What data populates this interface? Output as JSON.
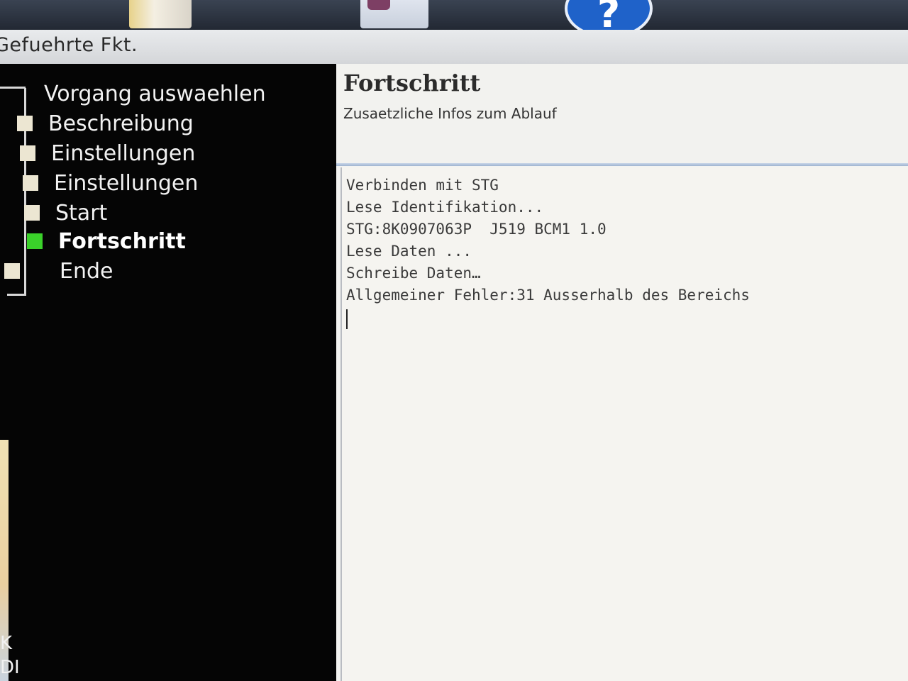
{
  "window": {
    "title": "Gefuehrte Fkt."
  },
  "taskbar": {
    "help_icon_glyph": "?"
  },
  "nav": {
    "items": [
      {
        "label": "Vorgang auswaehlen",
        "active": false
      },
      {
        "label": "Beschreibung",
        "active": false
      },
      {
        "label": "Einstellungen",
        "active": false
      },
      {
        "label": "Einstellungen",
        "active": false
      },
      {
        "label": "Start",
        "active": false
      },
      {
        "label": "Fortschritt",
        "active": true
      },
      {
        "label": "Ende",
        "active": false
      }
    ],
    "active_color": "#3ad12a",
    "strip_text": [
      "K",
      "DI"
    ]
  },
  "content": {
    "title": "Fortschritt",
    "subtitle": "Zusaetzliche Infos zum Ablauf",
    "log_lines": [
      "Verbinden mit STG",
      "Lese Identifikation...",
      "STG:8K0907063P  J519 BCM1 1.0",
      "Lese Daten ...",
      "Schreibe Daten…",
      "Allgemeiner Fehler:31 Ausserhalb des Bereichs"
    ]
  }
}
